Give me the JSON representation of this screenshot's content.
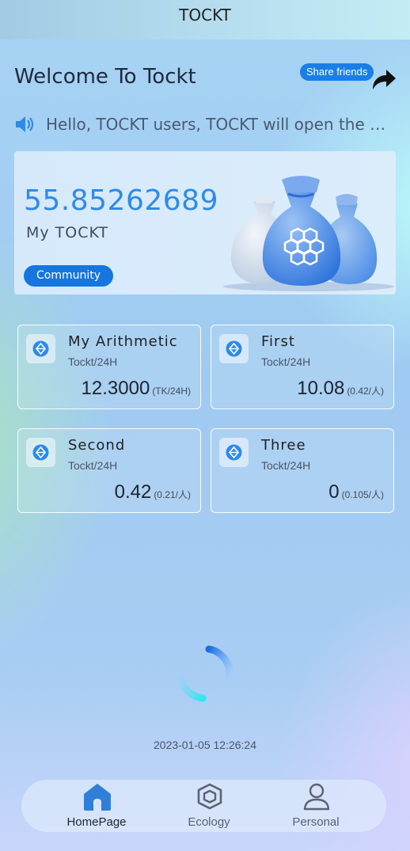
{
  "app": {
    "title": "TOCKT"
  },
  "header": {
    "welcome": "Welcome To Tockt",
    "share_label": "Share friends"
  },
  "notice": {
    "text": "Hello, TOCKT users, TOCKT will open the wo···"
  },
  "balance": {
    "value": "55.85262689",
    "label": "My TOCKT",
    "community_label": "Community"
  },
  "stats": [
    {
      "title": "My Arithmetic",
      "sub": "Tockt/24H",
      "value": "12.3000",
      "unit": "(TK/24H)"
    },
    {
      "title": "First",
      "sub": "Tockt/24H",
      "value": "10.08",
      "unit": "(0.42/人)"
    },
    {
      "title": "Second",
      "sub": "Tockt/24H",
      "value": "0.42",
      "unit": "(0.21/人)"
    },
    {
      "title": "Three",
      "sub": "Tockt/24H",
      "value": "0",
      "unit": "(0.105/人)"
    }
  ],
  "timestamp": "2023-01-05 12:26:24",
  "nav": {
    "items": [
      {
        "label": "HomePage",
        "icon": "home-icon",
        "active": true
      },
      {
        "label": "Ecology",
        "icon": "cube-icon",
        "active": false
      },
      {
        "label": "Personal",
        "icon": "user-icon",
        "active": false
      }
    ]
  },
  "colors": {
    "accent": "#1a7ee6",
    "balance_text": "#2f8ae6",
    "nav_active": "#2f7fd8",
    "nav_inactive": "#5a6372"
  }
}
